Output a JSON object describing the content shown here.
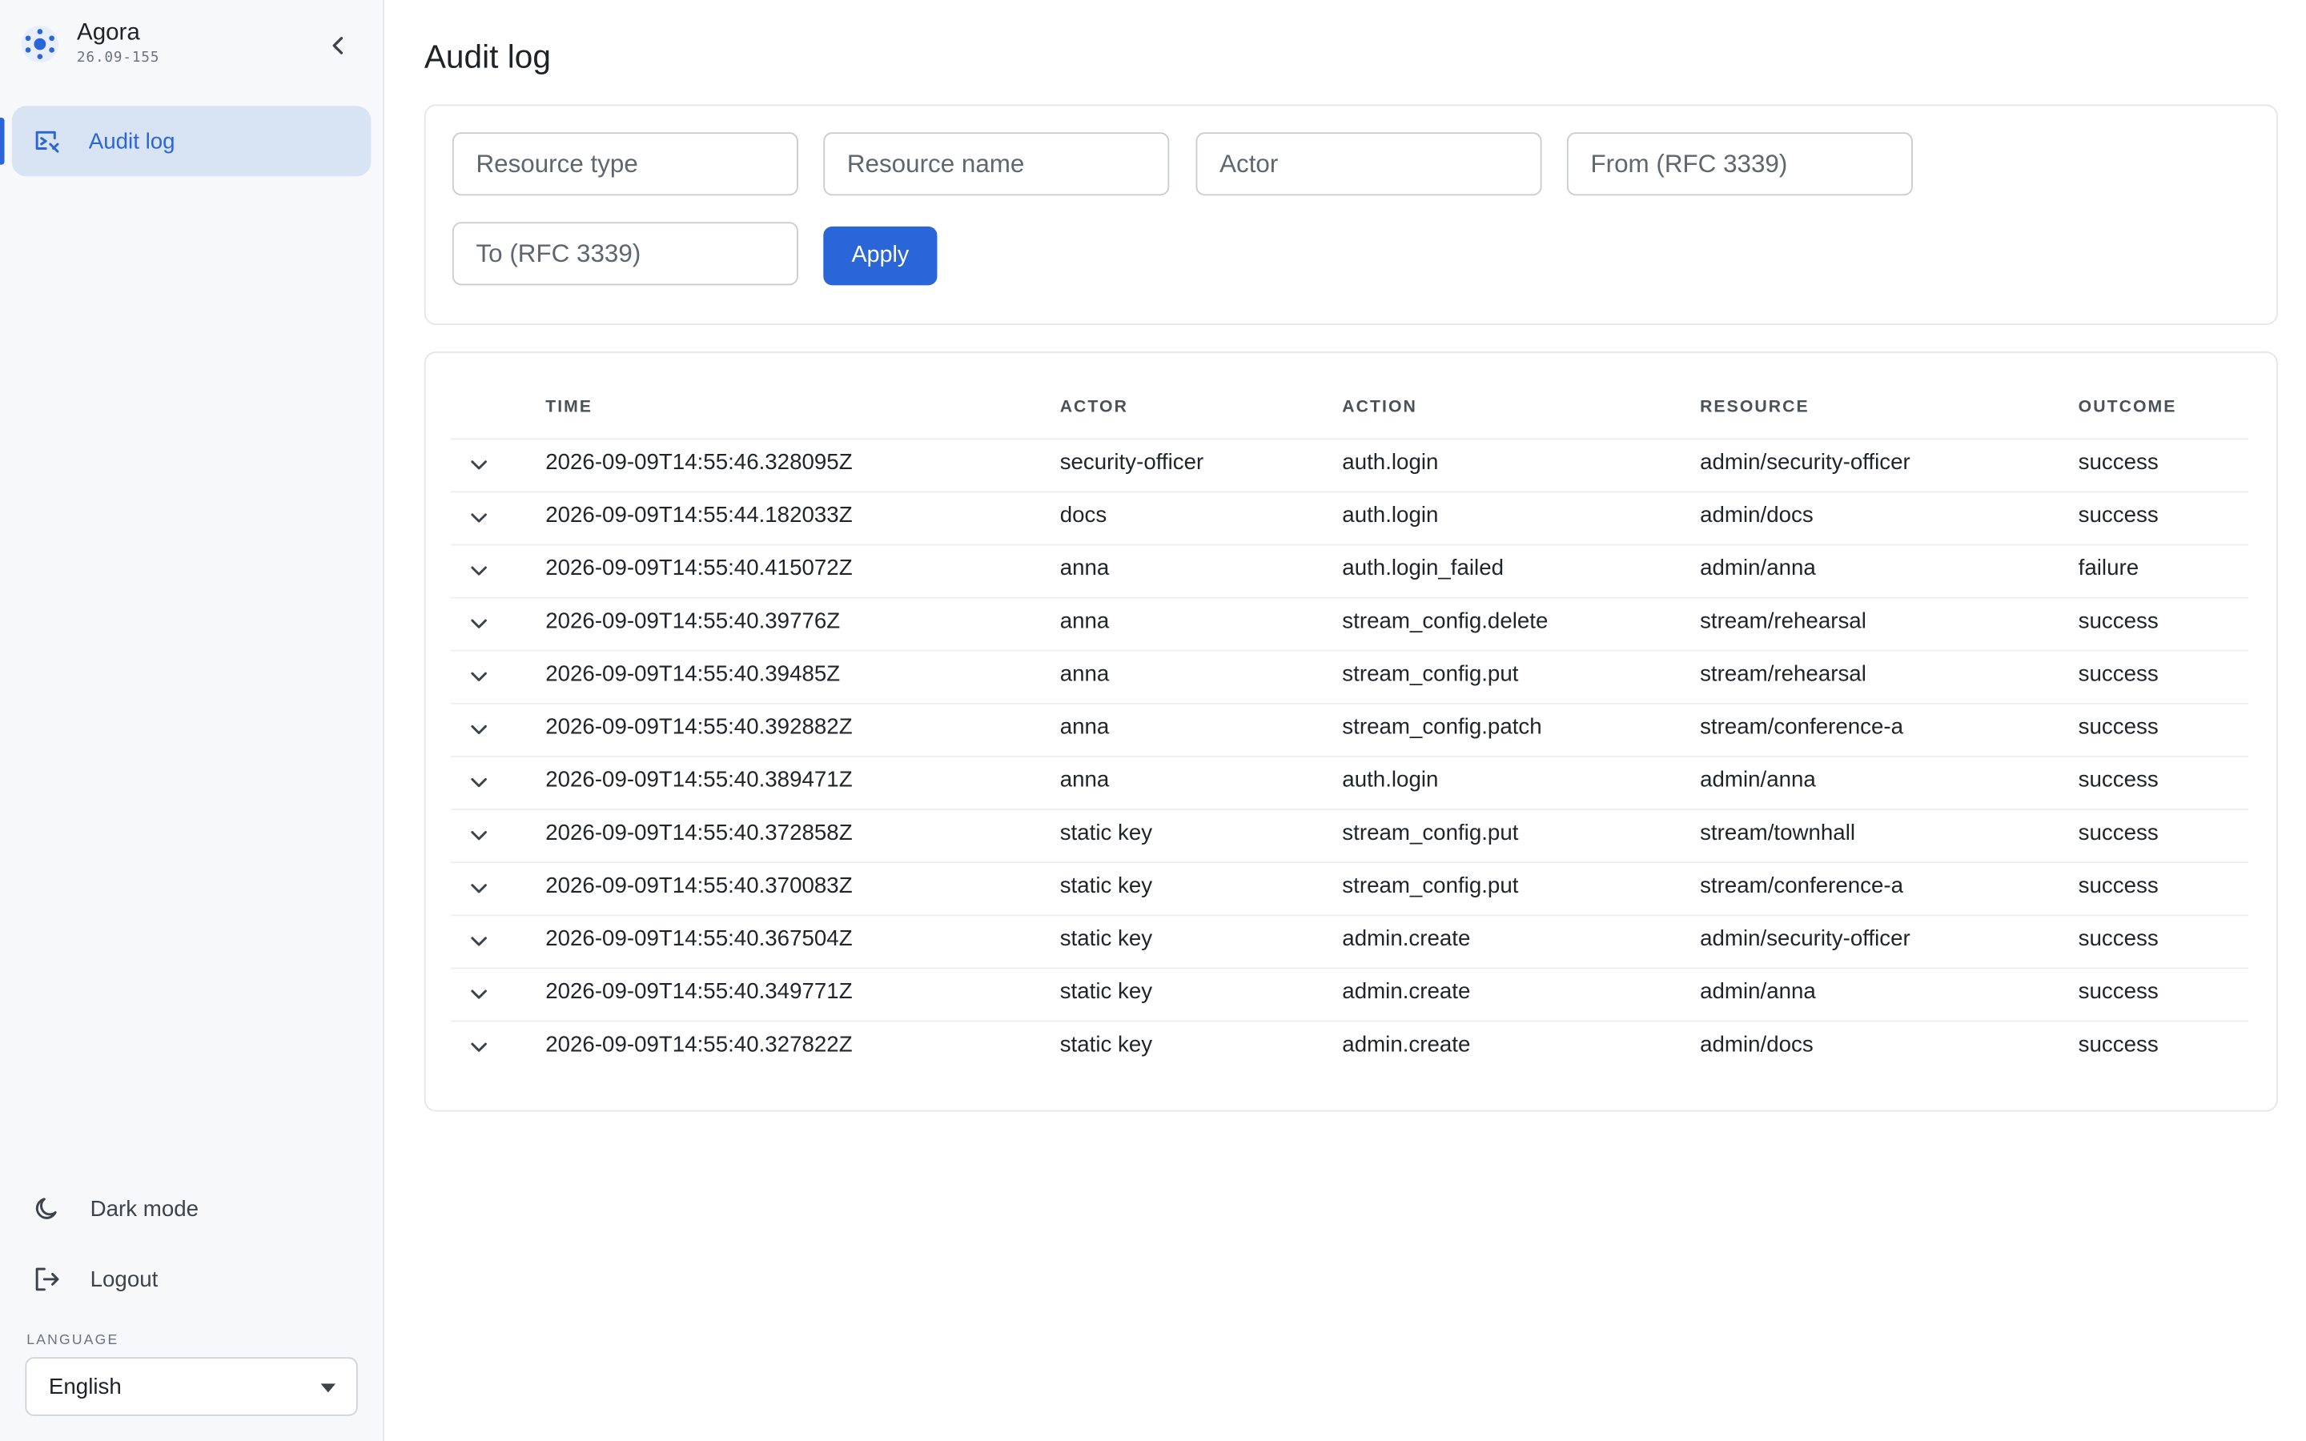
{
  "app": {
    "name": "Agora",
    "version": "26.09-155"
  },
  "sidebar": {
    "nav": [
      {
        "label": "Audit log",
        "icon": "audit-log-icon",
        "active": true
      }
    ],
    "dark_mode_label": "Dark mode",
    "logout_label": "Logout",
    "language_caption": "LANGUAGE",
    "language_selected": "English"
  },
  "page": {
    "title": "Audit log"
  },
  "filters": {
    "resource_type_placeholder": "Resource type",
    "resource_name_placeholder": "Resource name",
    "actor_placeholder": "Actor",
    "from_placeholder": "From (RFC 3339)",
    "to_placeholder": "To (RFC 3339)",
    "apply_label": "Apply"
  },
  "table": {
    "columns": [
      "TIME",
      "ACTOR",
      "ACTION",
      "RESOURCE",
      "OUTCOME"
    ],
    "rows": [
      [
        "2026-09-09T14:55:46.328095Z",
        "security-officer",
        "auth.login",
        "admin/security-officer",
        "success"
      ],
      [
        "2026-09-09T14:55:44.182033Z",
        "docs",
        "auth.login",
        "admin/docs",
        "success"
      ],
      [
        "2026-09-09T14:55:40.415072Z",
        "anna",
        "auth.login_failed",
        "admin/anna",
        "failure"
      ],
      [
        "2026-09-09T14:55:40.39776Z",
        "anna",
        "stream_config.delete",
        "stream/rehearsal",
        "success"
      ],
      [
        "2026-09-09T14:55:40.39485Z",
        "anna",
        "stream_config.put",
        "stream/rehearsal",
        "success"
      ],
      [
        "2026-09-09T14:55:40.392882Z",
        "anna",
        "stream_config.patch",
        "stream/conference-a",
        "success"
      ],
      [
        "2026-09-09T14:55:40.389471Z",
        "anna",
        "auth.login",
        "admin/anna",
        "success"
      ],
      [
        "2026-09-09T14:55:40.372858Z",
        "static key",
        "stream_config.put",
        "stream/townhall",
        "success"
      ],
      [
        "2026-09-09T14:55:40.370083Z",
        "static key",
        "stream_config.put",
        "stream/conference-a",
        "success"
      ],
      [
        "2026-09-09T14:55:40.367504Z",
        "static key",
        "admin.create",
        "admin/security-officer",
        "success"
      ],
      [
        "2026-09-09T14:55:40.349771Z",
        "static key",
        "admin.create",
        "admin/anna",
        "success"
      ],
      [
        "2026-09-09T14:55:40.327822Z",
        "static key",
        "admin.create",
        "admin/docs",
        "success"
      ]
    ]
  },
  "colors": {
    "accent": "#2b66d9",
    "nav_active_bg": "#d8e3f3",
    "sidebar_bg": "#f7f8fa"
  }
}
